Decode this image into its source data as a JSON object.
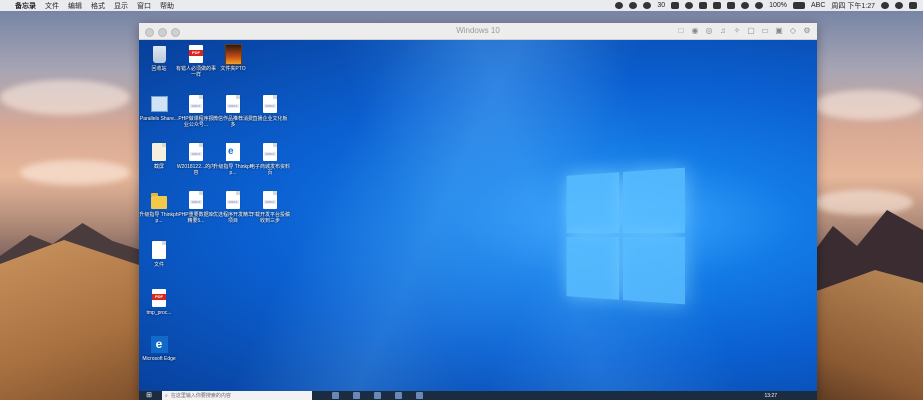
{
  "menubar": {
    "apple": "",
    "app": "备忘录",
    "menus": [
      "文件",
      "编辑",
      "格式",
      "显示",
      "窗口",
      "帮助"
    ],
    "status_count": "30",
    "battery": "100%",
    "input": "ABC",
    "datetime": "周四 下午1:27"
  },
  "vm": {
    "title": "Windows 10"
  },
  "desktop_icons": [
    {
      "label": "回收站"
    },
    {
      "label": "有错人必须做的事一样"
    },
    {
      "label": "文件夹PTO"
    },
    {
      "label": "Parallels Share..."
    },
    {
      "label": "PHP做课程序报业公众号..."
    },
    {
      "label": "微信作品推荐消费多"
    },
    {
      "label": "直播企业文化板"
    },
    {
      "label": "截屏"
    },
    {
      "label": "W2018122...的内容"
    },
    {
      "label": "升级指导 Thinkphp..."
    },
    {
      "label": "电子商城发布资料页"
    },
    {
      "label": "升级指导 Thinkphp..."
    },
    {
      "label": "PHP重要数据库精要5..."
    },
    {
      "label": "优选程序开发精华项目"
    },
    {
      "label": "下载开发平台投稿收到三步"
    },
    {
      "label": "文件"
    },
    {
      "label": "tmp_proc..."
    },
    {
      "label": "Microsoft Edge"
    }
  ],
  "taskbar": {
    "search_placeholder": "在这里输入你要搜索的内容",
    "time": "13:27"
  },
  "colors": {
    "win_blue": "#0b5fd0",
    "menubar": "#f0f0f2"
  }
}
